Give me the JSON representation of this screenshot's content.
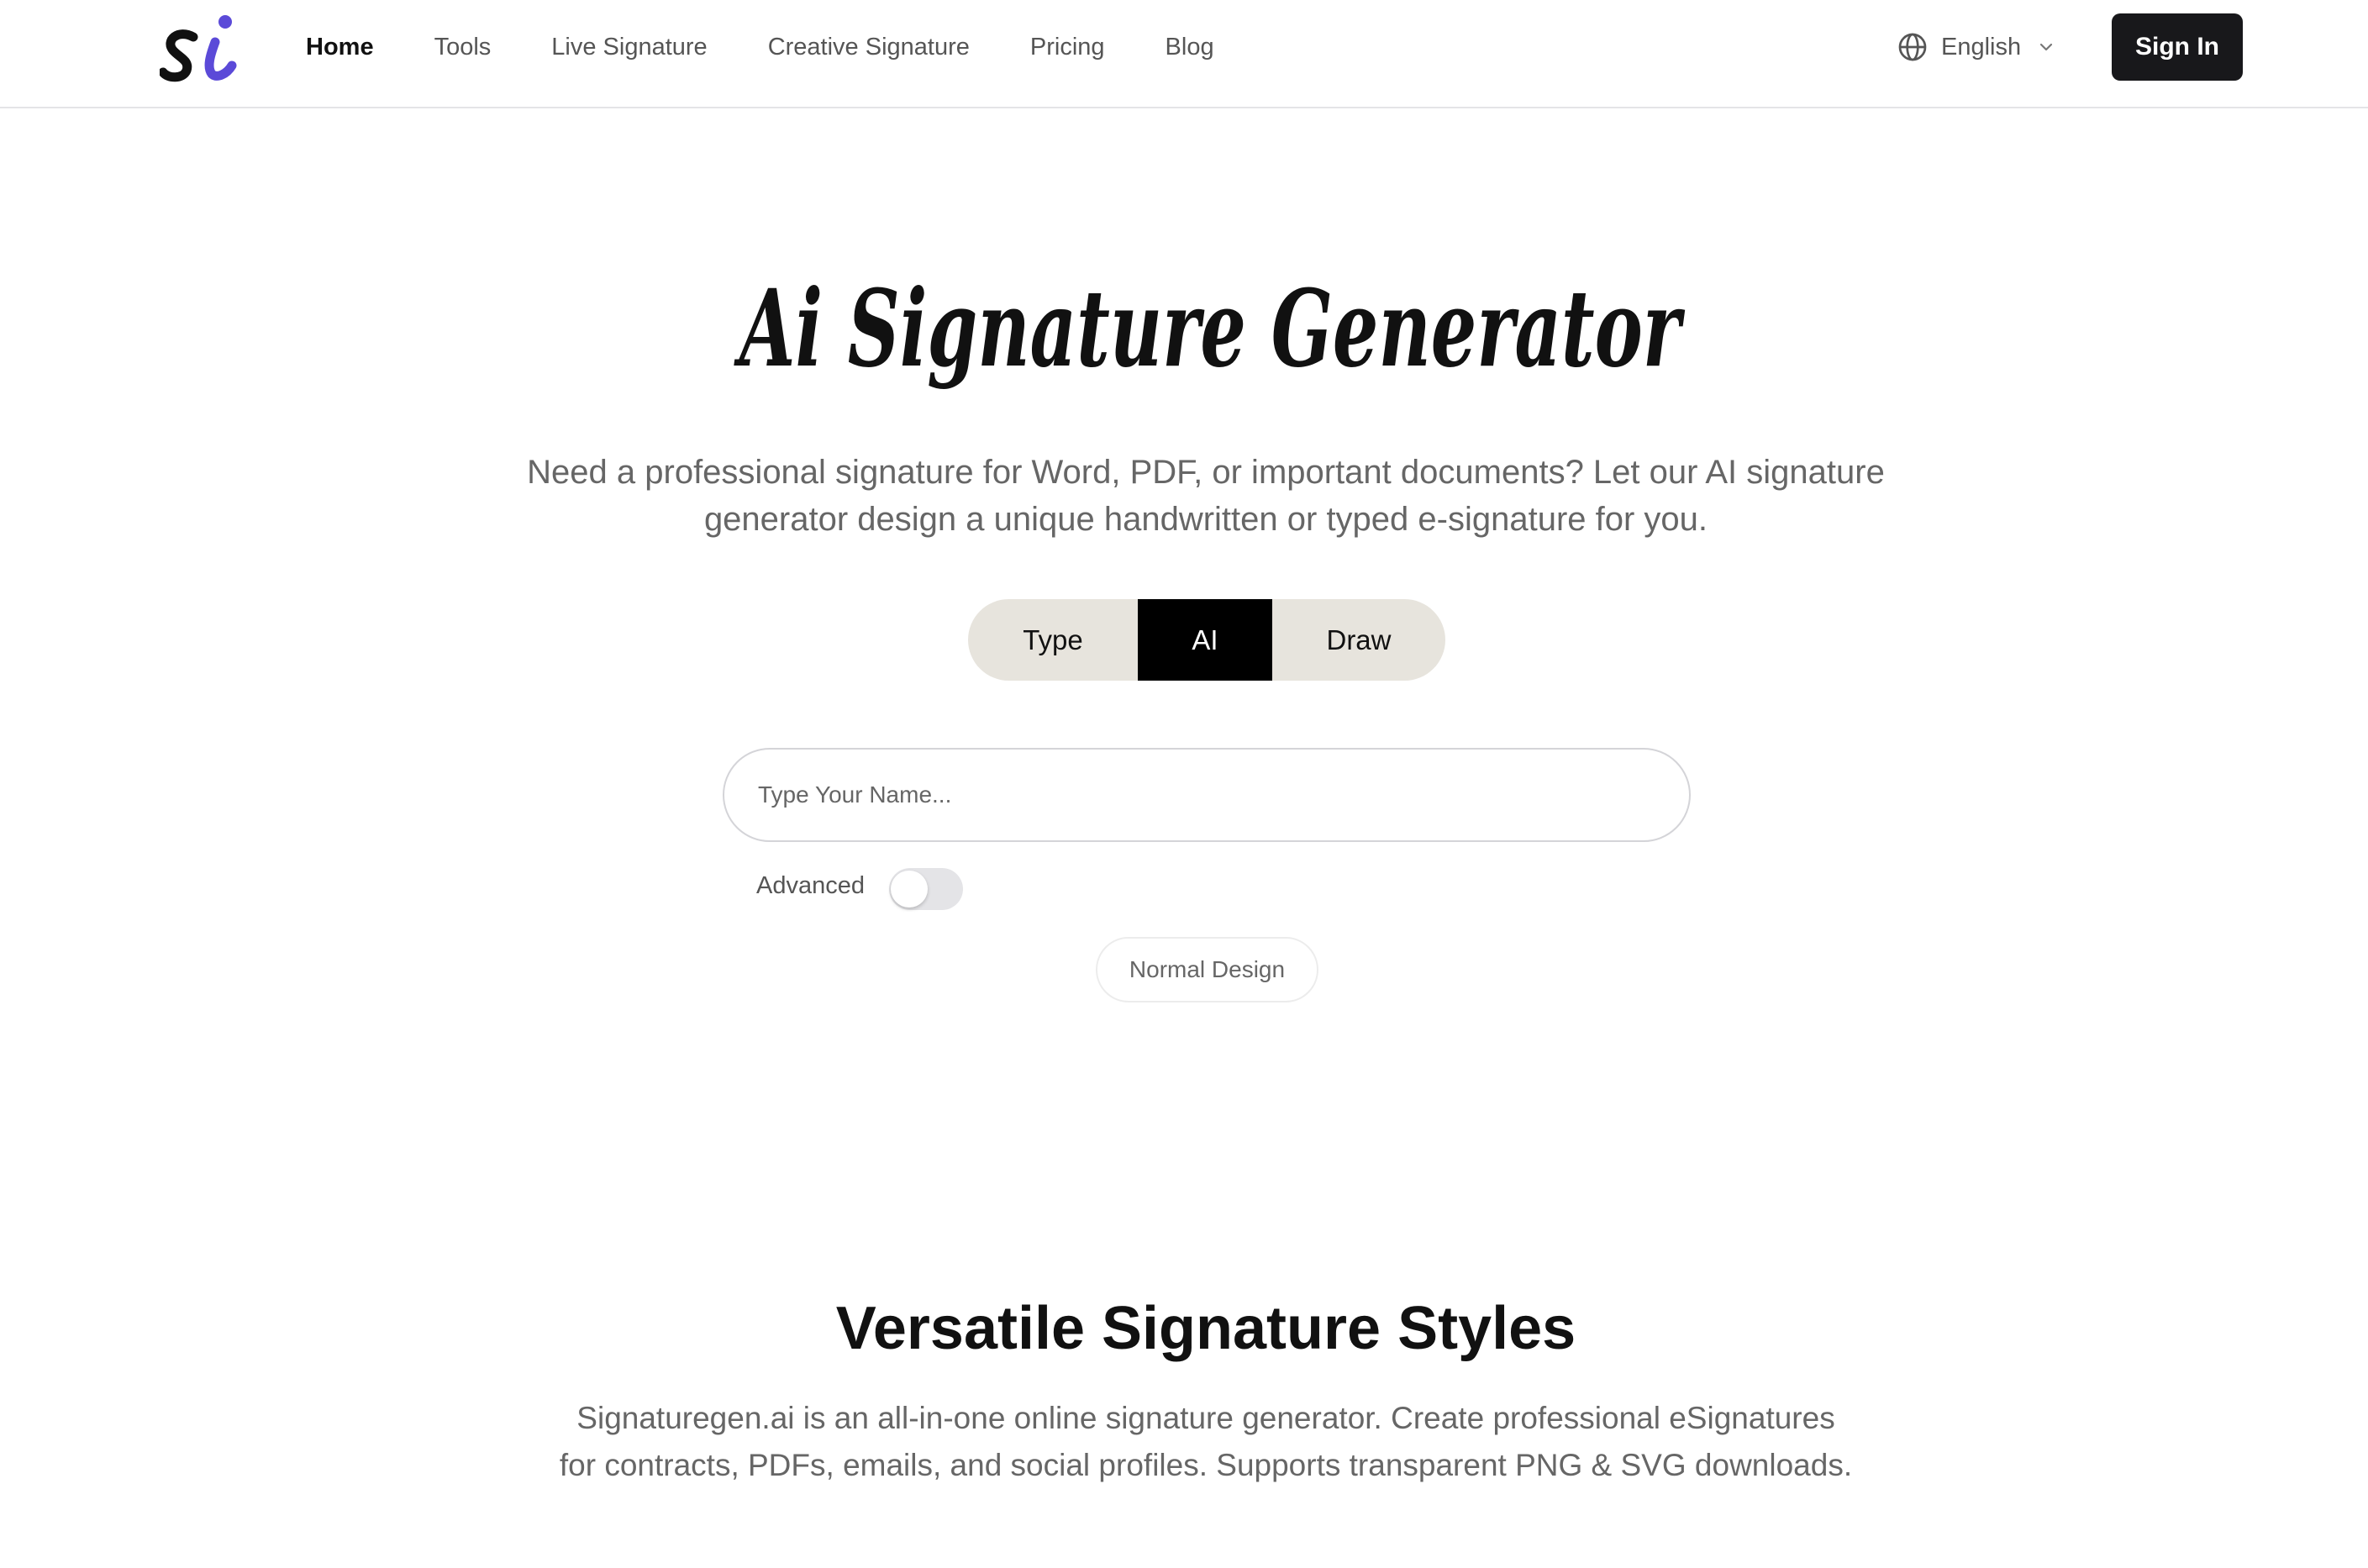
{
  "header": {
    "logo_text": "si",
    "nav": [
      {
        "label": "Home",
        "active": true
      },
      {
        "label": "Tools"
      },
      {
        "label": "Live Signature"
      },
      {
        "label": "Creative Signature"
      },
      {
        "label": "Pricing"
      },
      {
        "label": "Blog"
      }
    ],
    "language": "English",
    "signin_label": "Sign In"
  },
  "hero": {
    "title": "Ai Signature Generator",
    "description": "Need a professional signature for Word, PDF, or important documents? Let our AI signature generator design a unique handwritten or typed e-signature for you.",
    "modes": [
      "Type",
      "AI",
      "Draw"
    ],
    "selected_mode": "AI",
    "name_placeholder": "Type Your Name...",
    "name_value": "",
    "advanced_label": "Advanced",
    "advanced_enabled": false,
    "design_option": "Normal Design"
  },
  "section": {
    "title": "Versatile Signature Styles",
    "description": "Signaturegen.ai is an all-in-one online signature generator. Create professional eSignatures for contracts, PDFs, emails, and social profiles. Supports transparent PNG & SVG downloads."
  },
  "colors": {
    "accent": "#5b4ad8",
    "dark": "#18181b",
    "segment_bg": "#e7e4dd"
  },
  "icons": {
    "language": "globe-icon",
    "dropdown": "chevron-down-icon"
  }
}
